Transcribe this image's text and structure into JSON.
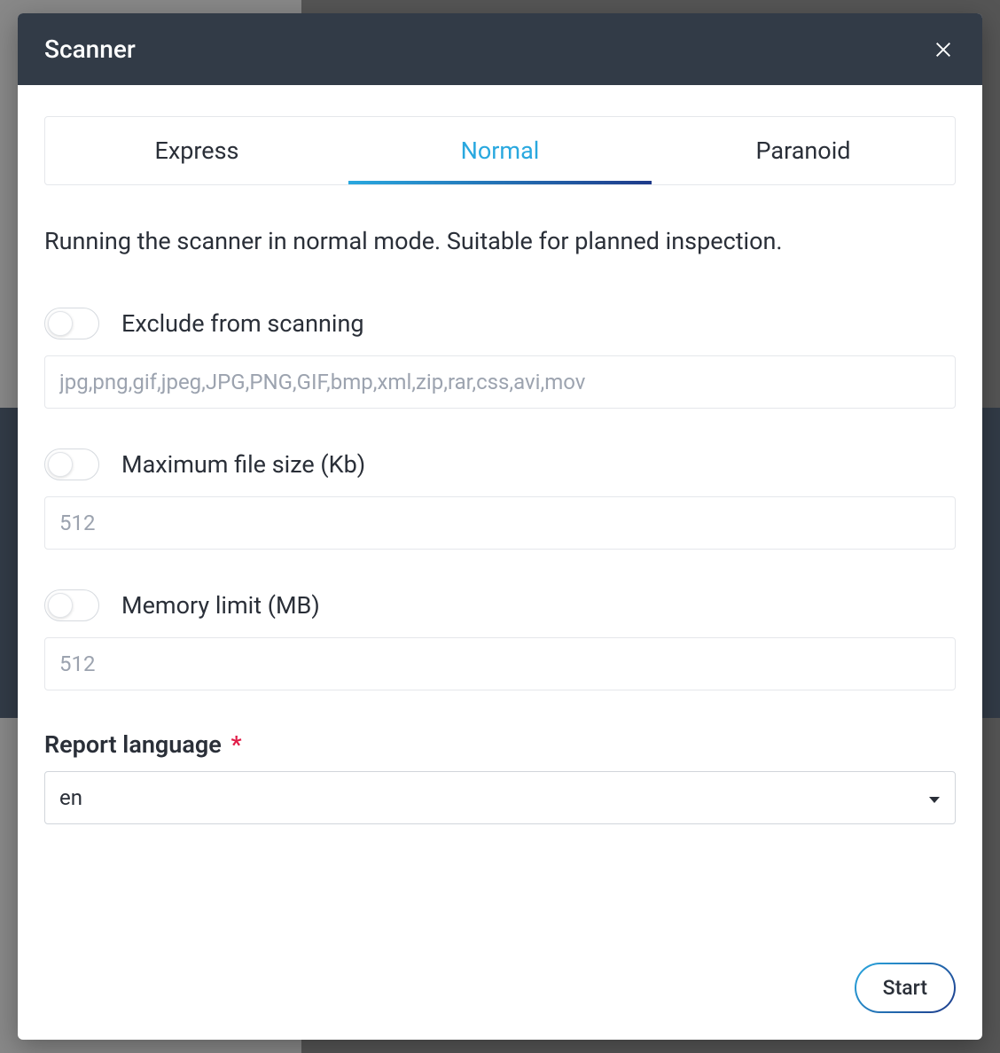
{
  "modal": {
    "title": "Scanner",
    "tabs": [
      {
        "label": "Express",
        "active": false
      },
      {
        "label": "Normal",
        "active": true
      },
      {
        "label": "Paranoid",
        "active": false
      }
    ],
    "description": "Running the scanner in normal mode. Suitable for planned inspection.",
    "fields": {
      "exclude": {
        "label": "Exclude from scanning",
        "value": "jpg,png,gif,jpeg,JPG,PNG,GIF,bmp,xml,zip,rar,css,avi,mov",
        "enabled": false
      },
      "maxsize": {
        "label": "Maximum file size (Kb)",
        "value": "512",
        "enabled": false
      },
      "memlimit": {
        "label": "Memory limit (MB)",
        "value": "512",
        "enabled": false
      },
      "language": {
        "label": "Report language",
        "required": "*",
        "value": "en"
      }
    },
    "buttons": {
      "start": "Start"
    }
  }
}
